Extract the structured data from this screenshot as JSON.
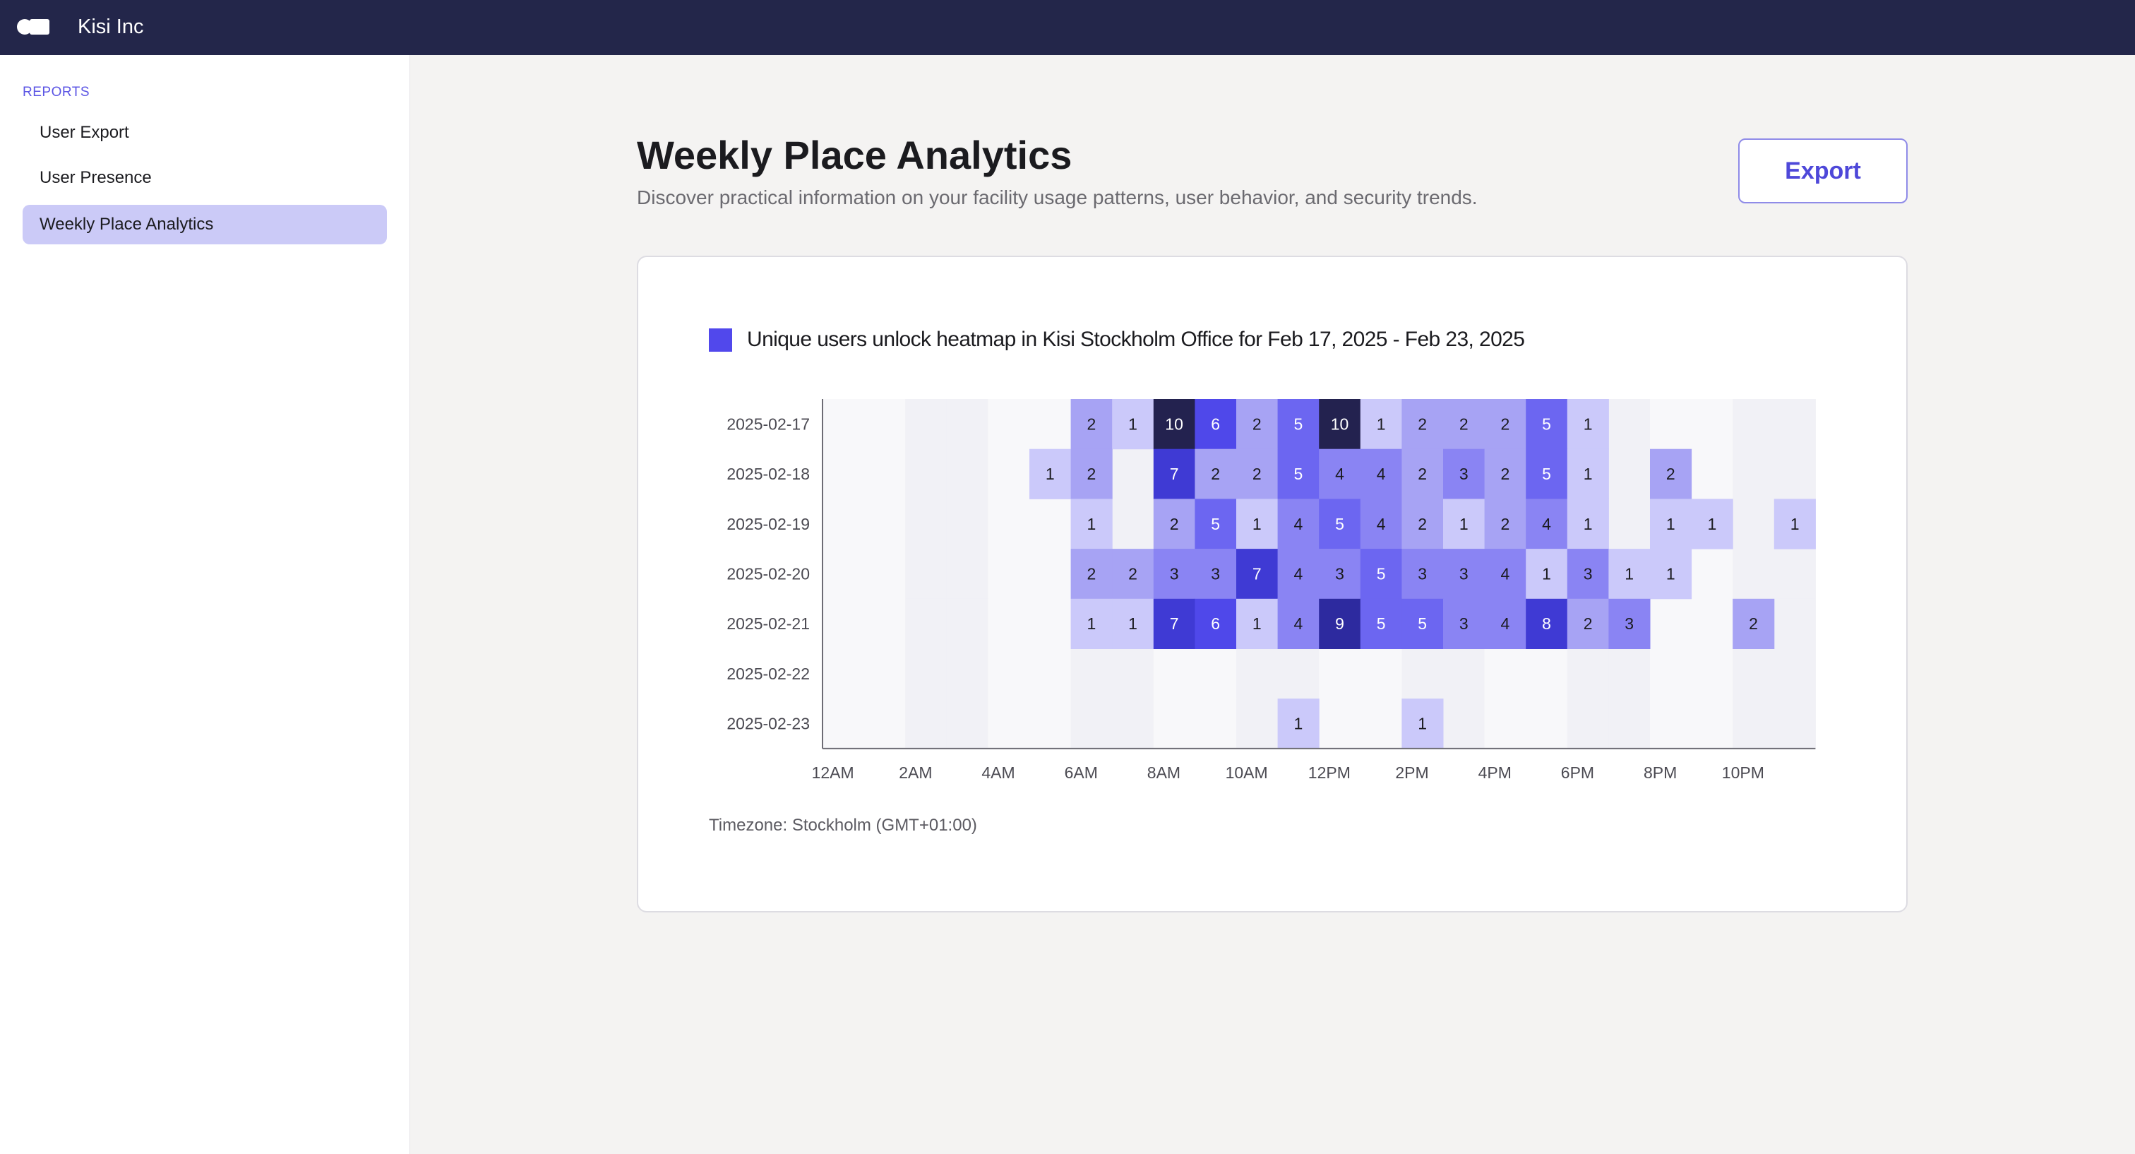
{
  "topbar": {
    "org_name": "Kisi Inc"
  },
  "sidebar": {
    "section_label": "REPORTS",
    "items": [
      {
        "label": "User Export",
        "active": false
      },
      {
        "label": "User Presence",
        "active": false
      },
      {
        "label": "Weekly Place Analytics",
        "active": true
      }
    ]
  },
  "page": {
    "title": "Weekly Place Analytics",
    "subtitle": "Discover practical information on your facility usage patterns, user behavior, and security trends.",
    "export_label": "Export"
  },
  "colors": {
    "accent": "#5148ec",
    "topbar": "#23264a",
    "heat_scale": [
      "#ffffff",
      "#cbc9fa",
      "#a7a3f4",
      "#8a84f3",
      "#6c66f1",
      "#4f48ea",
      "#3f3ad4",
      "#2d2a9f",
      "#23224f"
    ]
  },
  "chart_data": {
    "type": "heatmap",
    "title": "Unique users unlock heatmap in Kisi Stockholm Office for Feb 17, 2025 - Feb 23, 2025",
    "x_tick_labels": [
      "12AM",
      "2AM",
      "4AM",
      "6AM",
      "8AM",
      "10AM",
      "12PM",
      "2PM",
      "4PM",
      "6PM",
      "8PM",
      "10PM"
    ],
    "hours": [
      0,
      1,
      2,
      3,
      4,
      5,
      6,
      7,
      8,
      9,
      10,
      11,
      12,
      13,
      14,
      15,
      16,
      17,
      18,
      19,
      20,
      21,
      22,
      23
    ],
    "rows": [
      "2025-02-17",
      "2025-02-18",
      "2025-02-19",
      "2025-02-20",
      "2025-02-21",
      "2025-02-22",
      "2025-02-23"
    ],
    "values": [
      [
        0,
        0,
        0,
        0,
        0,
        0,
        2,
        1,
        10,
        6,
        2,
        5,
        10,
        1,
        2,
        2,
        2,
        5,
        1,
        0,
        0,
        0,
        0,
        0
      ],
      [
        0,
        0,
        0,
        0,
        0,
        1,
        2,
        0,
        7,
        2,
        2,
        5,
        4,
        4,
        2,
        3,
        2,
        5,
        1,
        0,
        2,
        0,
        0,
        0
      ],
      [
        0,
        0,
        0,
        0,
        0,
        0,
        1,
        0,
        2,
        5,
        1,
        4,
        5,
        4,
        2,
        1,
        2,
        4,
        1,
        0,
        1,
        1,
        0,
        1
      ],
      [
        0,
        0,
        0,
        0,
        0,
        0,
        2,
        2,
        3,
        3,
        7,
        4,
        3,
        5,
        3,
        3,
        4,
        1,
        3,
        1,
        1,
        0,
        0,
        0
      ],
      [
        0,
        0,
        0,
        0,
        0,
        0,
        1,
        1,
        7,
        6,
        1,
        4,
        9,
        5,
        5,
        3,
        4,
        8,
        2,
        3,
        0,
        0,
        2,
        0
      ],
      [
        0,
        0,
        0,
        0,
        0,
        0,
        0,
        0,
        0,
        0,
        0,
        0,
        0,
        0,
        0,
        0,
        0,
        0,
        0,
        0,
        0,
        0,
        0,
        0
      ],
      [
        0,
        0,
        0,
        0,
        0,
        0,
        0,
        0,
        0,
        0,
        0,
        1,
        0,
        0,
        1,
        0,
        0,
        0,
        0,
        0,
        0,
        0,
        0,
        0
      ]
    ],
    "grid": false,
    "legend_position": "top-left"
  },
  "footer": {
    "timezone": "Timezone: Stockholm (GMT+01:00)"
  }
}
